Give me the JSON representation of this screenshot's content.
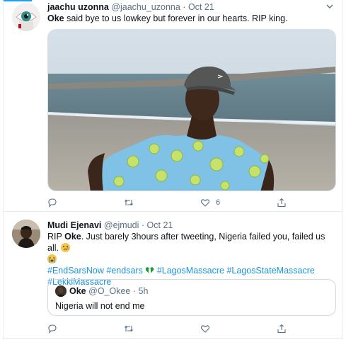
{
  "tweet1": {
    "display_name": "jaachu uzonna",
    "handle": "@jaachu_uzonna",
    "separator": "·",
    "time": "Oct 21",
    "mention": "Oke",
    "text": " said bye to us lowkey but forever in our hearts. RIP king.",
    "photo_alt": "Man in a grey cap and lime-print shirt posing on a beach",
    "actions": {
      "reply_count": "",
      "retweet_count": "",
      "like_count": "6"
    }
  },
  "tweet2": {
    "display_name": "Mudi Ejenavi",
    "handle": "@ejmudi",
    "separator": "·",
    "time": "Oct 21",
    "text_prefix": "RIP ",
    "mention": "Oke",
    "text_suffix": ". Just barely 3hours after tweeting, Nigeria failed you, failed us all.",
    "hashtags": [
      "#EndSarsNow",
      "#endsars",
      "#LagosMassacre",
      "#LagosStateMassacre",
      "#LekkiMassacre"
    ],
    "quote": {
      "display_name": "Oke",
      "handle": "@O_Okee",
      "separator": "·",
      "time": "5h",
      "text": "Nigeria will not end me"
    },
    "actions": {
      "reply_count": "",
      "retweet_count": "",
      "like_count": ""
    }
  },
  "colors": {
    "accent": "#1da1f2",
    "link": "#1b95e0",
    "secondary_text": "#5b7083",
    "border": "#e6ecf0"
  },
  "icons": [
    "reply-icon",
    "retweet-icon",
    "like-icon",
    "share-icon",
    "chevron-down-icon",
    "crying-emoji-icon",
    "sobbing-emoji-icon",
    "nigeria-flag-heart-icon"
  ]
}
